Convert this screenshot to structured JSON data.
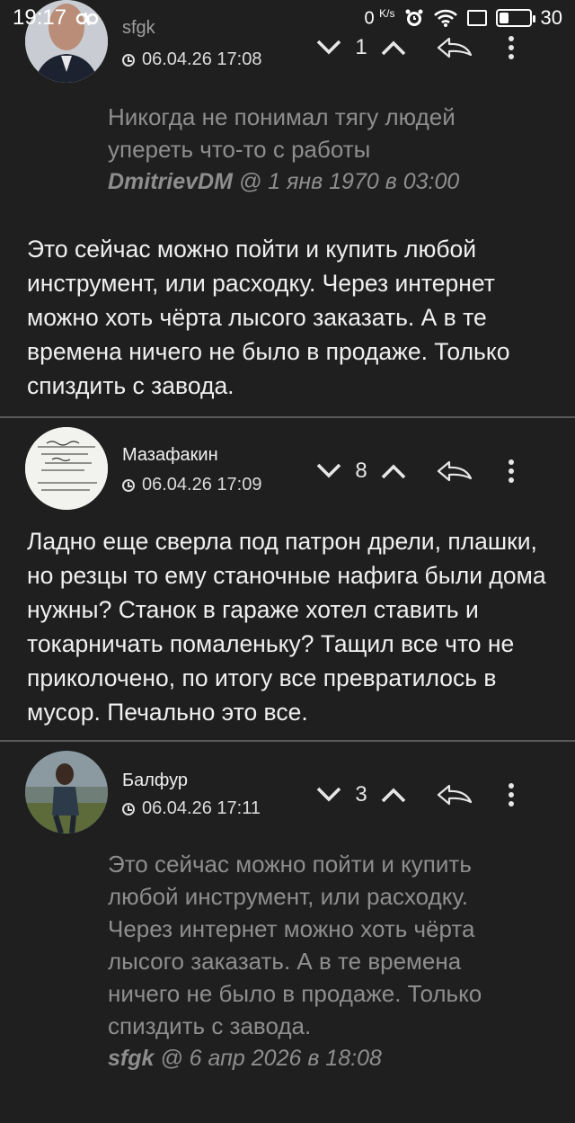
{
  "status_bar": {
    "time": "19:17",
    "net_speed": "0",
    "net_unit": "K/s",
    "battery": "30",
    "battery_level": 0.3
  },
  "comments": [
    {
      "author": "sfgk",
      "date": "06.04.26 17:08",
      "rating": "1",
      "quote": {
        "text": "Никогда не понимал тягу людей упереть что-то с работы",
        "author": "DmitrievDM",
        "when": " @ 1 янв 1970 в 03:00"
      },
      "body": "Это сейчас можно пойти и купить любой инструмент, или расходку. Через интернет можно хоть чёрта лысого заказать. А в те времена ничего не было в продаже. Только спиздить с завода."
    },
    {
      "author": "Мазафакин",
      "date": "06.04.26 17:09",
      "rating": "8",
      "avatar_text": [
        "По беззаслуг",
        "...замечания боши",
        "- Попробуйте",
        "...воспитай Ясенев",
        "... ",
        "не какатьник упорное в",
        "...начинать в ухо..."
      ],
      "body": "Ладно еще сверла под патрон дрели, плашки, но резцы то ему станочные нафига были дома нужны? Станок в гараже хотел ставить и токарничать помаленьку? Тащил все что не приколочено, по итогу все превратилось в мусор. Печально это все."
    },
    {
      "author": "Балфур",
      "date": "06.04.26 17:11",
      "rating": "3",
      "quote": {
        "text": "Это сейчас можно пойти и купить любой инструмент, или расходку. Через интернет можно хоть чёрта лысого заказать. А в те времена ничего не было в продаже. Только спиздить с завода.",
        "author": "sfgk",
        "when": " @ 6 апр 2026 в 18:08"
      }
    }
  ]
}
